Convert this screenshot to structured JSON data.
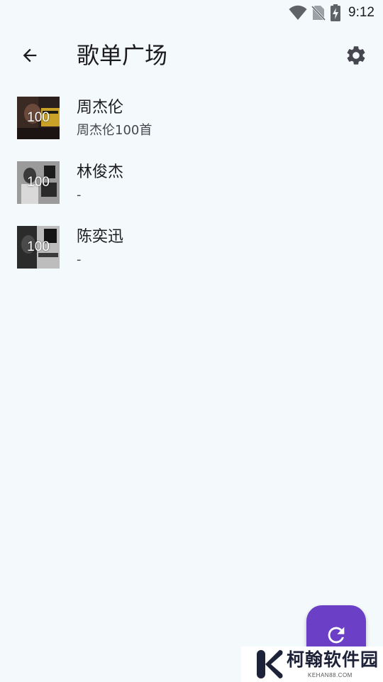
{
  "status_bar": {
    "time": "9:12",
    "icons": [
      "wifi-icon",
      "no-sim-icon",
      "battery-charging-icon"
    ]
  },
  "app_bar": {
    "back_icon": "arrow-left-icon",
    "title": "歌单广场",
    "settings_icon": "gear-icon"
  },
  "playlists": [
    {
      "title": "周杰伦",
      "subtitle": "周杰伦100首",
      "count": "100"
    },
    {
      "title": "林俊杰",
      "subtitle": "-",
      "count": "100"
    },
    {
      "title": "陈奕迅",
      "subtitle": "-",
      "count": "100"
    }
  ],
  "fab": {
    "icon": "refresh-icon"
  },
  "watermark": {
    "name": "柯翰软件园",
    "url": "KEHAN88.COM"
  },
  "colors": {
    "background": "#f4fafb",
    "accent": "#6b3fc6",
    "text_primary": "#1b1b1f",
    "text_secondary": "#46464f"
  }
}
